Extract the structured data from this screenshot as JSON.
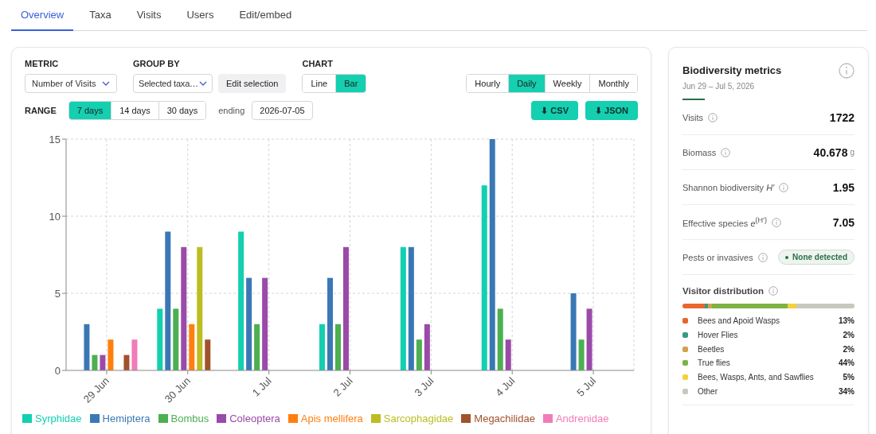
{
  "tabs": [
    {
      "label": "Overview",
      "selected": true
    },
    {
      "label": "Taxa",
      "selected": false
    },
    {
      "label": "Visits",
      "selected": false
    },
    {
      "label": "Users",
      "selected": false
    },
    {
      "label": "Edit/embed",
      "selected": false
    }
  ],
  "controls": {
    "metric": {
      "label": "METRIC",
      "value": "Number of Visits"
    },
    "group_by": {
      "label": "GROUP BY",
      "value": "Selected taxa…",
      "button": "Edit selection"
    },
    "chart": {
      "label": "CHART",
      "options": [
        {
          "label": "Line",
          "selected": false
        },
        {
          "label": "Bar",
          "selected": true
        }
      ]
    },
    "interval": [
      {
        "label": "Hourly",
        "selected": false
      },
      {
        "label": "Daily",
        "selected": true
      },
      {
        "label": "Weekly",
        "selected": false
      },
      {
        "label": "Monthly",
        "selected": false
      }
    ],
    "range": {
      "label": "RANGE",
      "options": [
        {
          "label": "7 days",
          "selected": true
        },
        {
          "label": "14 days",
          "selected": false
        },
        {
          "label": "30 days",
          "selected": false
        }
      ],
      "ending_label": "ending",
      "ending": "2026-07-05"
    },
    "downloads": [
      "⬇ CSV",
      "⬇ JSON"
    ]
  },
  "chart_data": {
    "type": "bar",
    "grid": true,
    "legend": true,
    "categories": [
      "29 Jun",
      "30 Jun",
      "1 Jul",
      "2 Jul",
      "3 Jul",
      "4 Jul",
      "5 Jul"
    ],
    "ylim": [
      0,
      15
    ],
    "yticks": [
      0,
      5,
      10,
      15
    ],
    "series": [
      {
        "name": "Syrphidae",
        "color": "#12d0b0",
        "values": [
          0,
          4,
          9,
          3,
          8,
          12,
          0
        ]
      },
      {
        "name": "Hemiptera",
        "color": "#3a78b5",
        "values": [
          3,
          9,
          6,
          6,
          8,
          15,
          5
        ]
      },
      {
        "name": "Bombus",
        "color": "#4caf50",
        "values": [
          1,
          4,
          3,
          3,
          2,
          4,
          2
        ]
      },
      {
        "name": "Coleoptera",
        "color": "#9a4aa8",
        "values": [
          1,
          8,
          6,
          8,
          3,
          2,
          4
        ]
      },
      {
        "name": "Apis mellifera",
        "color": "#ff7f0e",
        "values": [
          2,
          3,
          0,
          0,
          0,
          0,
          0
        ]
      },
      {
        "name": "Sarcophagidae",
        "color": "#bcbd22",
        "values": [
          0,
          8,
          0,
          0,
          0,
          0,
          0
        ]
      },
      {
        "name": "Megachilidae",
        "color": "#a0522d",
        "values": [
          1,
          2,
          0,
          0,
          0,
          0,
          0
        ]
      },
      {
        "name": "Andrenidae",
        "color": "#f17cb8",
        "values": [
          2,
          0,
          0,
          0,
          0,
          0,
          0
        ]
      }
    ]
  },
  "metrics": {
    "title": "Biodiversity metrics",
    "dates": "Jun 29 – Jul 5, 2026",
    "rows": [
      {
        "kind": "value",
        "label": "Visits",
        "value": "1722"
      },
      {
        "kind": "value",
        "label": "Biomass",
        "value": "40.678",
        "unit": "g"
      },
      {
        "kind": "value",
        "label": "Shannon biodiversity *H′*",
        "value": "1.95"
      },
      {
        "kind": "value",
        "label": "Effective species *e*$^{(H′)}$",
        "value": "7.05"
      },
      {
        "kind": "badge",
        "label": "Pests or invasives",
        "value": "None detected"
      }
    ],
    "distribution": {
      "title": "Visitor distribution",
      "items": [
        {
          "label": "Bees and Apoid Wasps",
          "pct": "13%",
          "color": "#e8662e"
        },
        {
          "label": "Hover Flies",
          "pct": "2%",
          "color": "#3a9a80"
        },
        {
          "label": "Beetles",
          "pct": "2%",
          "color": "#d4a04a"
        },
        {
          "label": "True flies",
          "pct": "44%",
          "color": "#7cb342"
        },
        {
          "label": "Bees, Wasps, Ants, and Sawflies",
          "pct": "5%",
          "color": "#f4d03f"
        },
        {
          "label": "Other",
          "pct": "34%",
          "color": "#c8c8c0"
        }
      ]
    }
  }
}
